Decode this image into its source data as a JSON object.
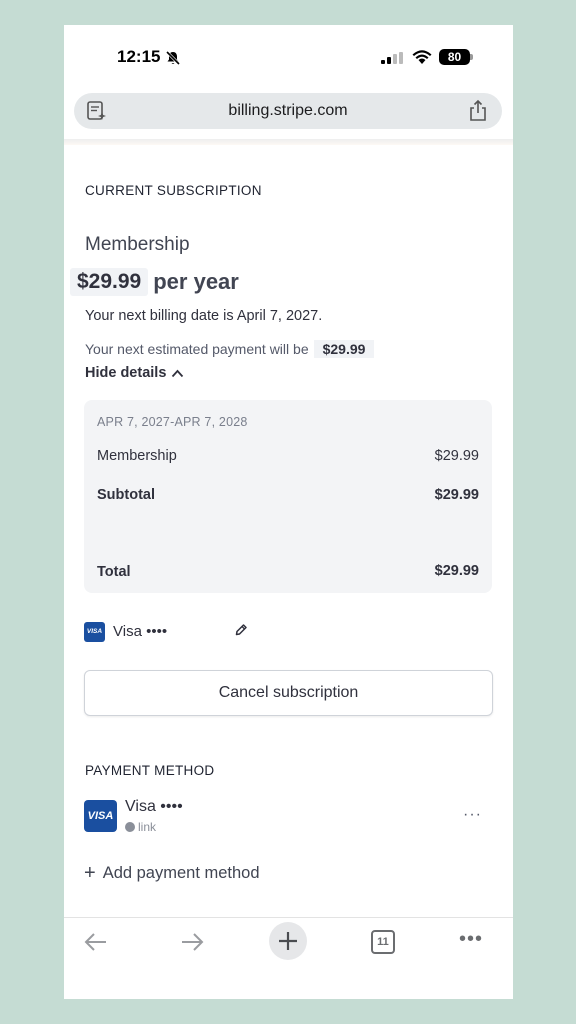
{
  "status_bar": {
    "time": "12:15",
    "battery": "80"
  },
  "browser": {
    "url": "billing.stripe.com",
    "tab_count": "11"
  },
  "subscription": {
    "section_title": "CURRENT SUBSCRIPTION",
    "plan_name": "Membership",
    "price": "$29.99",
    "price_unit": "per year",
    "next_billing": "Your next billing date is April 7, 2027.",
    "estimated_prefix": "Your next estimated payment will be",
    "estimated_amount": "$29.99",
    "toggle_label": "Hide details",
    "details": {
      "period": "APR 7, 2027-APR 7, 2028",
      "item_label": "Membership",
      "item_value": "$29.99",
      "subtotal_label": "Subtotal",
      "subtotal_value": "$29.99",
      "total_label": "Total",
      "total_value": "$29.99"
    },
    "card_brand": "VISA",
    "card_label": "Visa ••••",
    "cancel_label": "Cancel subscription"
  },
  "payment_method": {
    "section_title": "PAYMENT METHOD",
    "card_brand": "VISA",
    "card_label": "Visa ••••",
    "sub_label": "link",
    "more_label": "···",
    "add_label": "Add payment method"
  },
  "colors": {
    "background": "#c5dcd3",
    "visa_blue": "#1a4fa0",
    "text": "#30313d"
  }
}
